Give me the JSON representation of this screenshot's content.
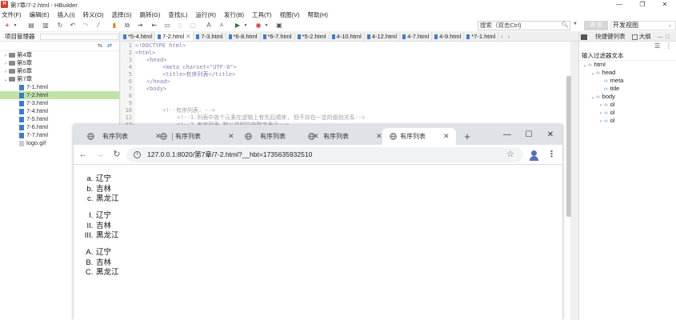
{
  "hbuilder": {
    "window_title": "第7章/7-2.html - HBuilder",
    "logo_letter": "H",
    "menu": [
      "文件(F)",
      "编辑(E)",
      "插入(I)",
      "转义(O)",
      "选择(S)",
      "跳转(G)",
      "查找(L)",
      "运行(R)",
      "发行(B)",
      "工具(T)",
      "视图(V)",
      "帮助(H)"
    ],
    "search_placeholder": "搜索（双击Ctrl)",
    "mode_chip": "浏 览",
    "mode_label": "开发视图",
    "project_panel_title": "项目管理器",
    "tree": [
      {
        "label": "第4章",
        "type": "folder",
        "arrow": "›"
      },
      {
        "label": "第5章",
        "type": "folder",
        "arrow": "›"
      },
      {
        "label": "第6章",
        "type": "folder",
        "arrow": "›"
      },
      {
        "label": "第7章",
        "type": "folder",
        "arrow": "⌄"
      },
      {
        "label": "7-1.html",
        "type": "file"
      },
      {
        "label": "7-2.html",
        "type": "file"
      },
      {
        "label": "7-3.html",
        "type": "file"
      },
      {
        "label": "7-4.html",
        "type": "file"
      },
      {
        "label": "7-5.html",
        "type": "file"
      },
      {
        "label": "7-6.html",
        "type": "file"
      },
      {
        "label": "7-7.html",
        "type": "file"
      },
      {
        "label": "logo.gif",
        "type": "gif"
      }
    ],
    "editor_tabs": [
      "*5-4.html",
      "7-2.html",
      "7-3.html",
      "*6-8.html",
      "*6-7.html",
      "*5-2.html",
      "4-10.html",
      "4-12.html",
      "4-7.html",
      "4-9.html",
      "*7-1.html"
    ],
    "code": [
      {
        "n": "1",
        "fold": "",
        "text": "<!DOCTYPE html>",
        "cls": "c-tag",
        "indent": 0
      },
      {
        "n": "2",
        "fold": "⊖",
        "text": "<html>",
        "cls": "c-tag",
        "indent": 0
      },
      {
        "n": "3",
        "fold": "⊖",
        "text": "<head>",
        "cls": "c-tag",
        "indent": 18
      },
      {
        "n": "4",
        "fold": "",
        "text": "<meta charset=\"UTF-8\">",
        "cls": "c-tag",
        "indent": 38
      },
      {
        "n": "5",
        "fold": "",
        "text": "<title>有序列表</title>",
        "cls": "c-tag",
        "indent": 38
      },
      {
        "n": "6",
        "fold": "",
        "text": "</head>",
        "cls": "c-tag",
        "indent": 18
      },
      {
        "n": "7",
        "fold": "⊖",
        "text": "<body>",
        "cls": "c-tag",
        "indent": 18
      },
      {
        "n": "8",
        "fold": "",
        "text": "",
        "cls": "c-txt",
        "indent": 0
      },
      {
        "n": "9",
        "fold": "",
        "text": "",
        "cls": "c-txt",
        "indent": 0
      },
      {
        "n": "10",
        "fold": "",
        "text": "<!--有序列表: -->",
        "cls": "c-cmt",
        "indent": 38
      },
      {
        "n": "11",
        "fold": "",
        "text": "<!--1.列表中各个元素在逻辑上有先后顺序, 但不存在一定的级别关系-->",
        "cls": "c-cmt",
        "indent": 56
      },
      {
        "n": "12",
        "fold": "",
        "text": "<!--2.有序列表 默认用阿拉伯数字表示-->",
        "cls": "c-cmt",
        "indent": 56
      }
    ],
    "right_tabs": {
      "active": "快捷键列表",
      "other": "大纲"
    },
    "filter_label": "输入过滤器文本",
    "dom_tree": [
      {
        "label": "html",
        "arrow": "⌄",
        "indent": 3
      },
      {
        "label": "head",
        "arrow": "⌄",
        "indent": 13
      },
      {
        "label": "meta",
        "arrow": "",
        "indent": 23
      },
      {
        "label": "title",
        "arrow": "",
        "indent": 23
      },
      {
        "label": "body",
        "arrow": "⌄",
        "indent": 13
      },
      {
        "label": "ol",
        "arrow": "›",
        "indent": 23
      },
      {
        "label": "ol",
        "arrow": "›",
        "indent": 23
      },
      {
        "label": "ol",
        "arrow": "›",
        "indent": 23
      }
    ]
  },
  "browser": {
    "tabs": [
      {
        "title": "有序列表",
        "active": false
      },
      {
        "title": "有序列表",
        "active": false
      },
      {
        "title": "有序列表",
        "active": false
      },
      {
        "title": "有序列表",
        "active": true
      }
    ],
    "new_tab": "+",
    "url": "127.0.0.1:8020/第7章/7-2.html?__hbt=1735635932510",
    "content": {
      "list1": [
        "辽宁",
        "吉林",
        "黑龙江"
      ],
      "list2": [
        "辽宁",
        "吉林",
        "黑龙江"
      ],
      "list3": [
        "辽宁",
        "吉林",
        "黑龙江"
      ]
    }
  }
}
